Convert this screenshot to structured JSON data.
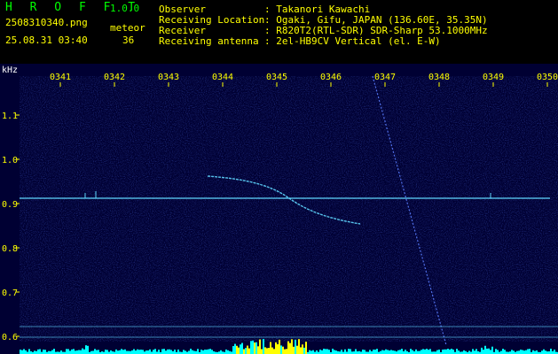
{
  "header": {
    "app_name": "H R O F F T",
    "version": "1.0.0",
    "filename": "2508310340.png",
    "meteor_label": "meteor",
    "meteor_count": "36",
    "timestamp": "25.08.31 03:40",
    "fields": [
      {
        "label": "Observer",
        "value": ": Takanori Kawachi"
      },
      {
        "label": "Receiving Location",
        "value": ": Ogaki, Gifu, JAPAN (136.60E, 35.35N)"
      },
      {
        "label": "Receiver",
        "value": ": R820T2(RTL-SDR) SDR-Sharp 53.1000MHz"
      },
      {
        "label": "Receiving antenna",
        "value": ": 2el-HB9CV Vertical (el. E-W)"
      }
    ]
  },
  "chart_data": {
    "type": "heatmap",
    "ylabel": "kHz",
    "y_ticks": [
      "1.1",
      "1.0",
      "0.9",
      "0.8",
      "0.7",
      "0.6"
    ],
    "x_ticks": [
      "0341",
      "0342",
      "0343",
      "0344",
      "0345",
      "0346",
      "0347",
      "0348",
      "0349",
      "0350"
    ],
    "colors": {
      "background": "#000033",
      "trace": "#5fd7ff",
      "tick_label": "#ffff00",
      "axis_label": "#ffffff",
      "bottom_bars": "#00ffff",
      "peak_bars": "#ffff00"
    }
  }
}
